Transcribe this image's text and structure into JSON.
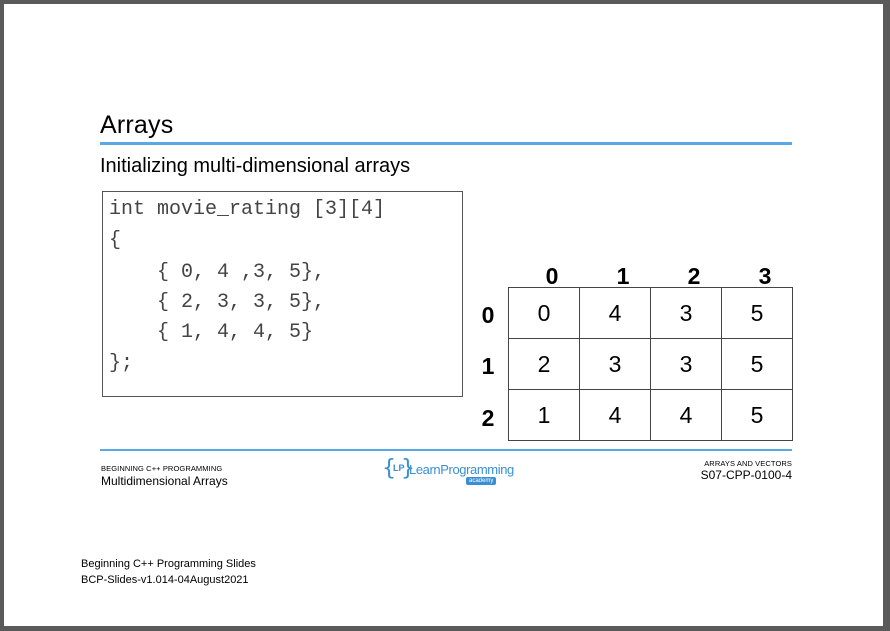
{
  "slide": {
    "title": "Arrays",
    "subtitle": "Initializing multi-dimensional arrays"
  },
  "code": {
    "lines": [
      "int movie_rating [3][4]",
      "{",
      "    { 0, 4 ,3, 5},",
      "    { 2, 3, 3, 5},",
      "    { 1, 4, 4, 5}",
      "};"
    ]
  },
  "grid": {
    "column_headers": [
      "0",
      "1",
      "2",
      "3"
    ],
    "row_headers": [
      "0",
      "1",
      "2"
    ],
    "rows": [
      [
        "0",
        "4",
        "3",
        "5"
      ],
      [
        "2",
        "3",
        "3",
        "5"
      ],
      [
        "1",
        "4",
        "4",
        "5"
      ]
    ]
  },
  "footer": {
    "left_small": "BEGINNING C++ PROGRAMMING",
    "left_main": "Multidimensional Arrays",
    "right_small": "ARRAYS AND VECTORS",
    "right_main": "S07-CPP-0100-4",
    "logo": {
      "text": "LearnProgramming",
      "badge": "academy",
      "initials": "LP"
    }
  },
  "document_info": {
    "line1": "Beginning C++ Programming Slides",
    "line2": "BCP-Slides-v1.014-04August2021"
  },
  "colors": {
    "accent_rule": "#5aa9e6",
    "logo_blue": "#3a8fd4"
  }
}
